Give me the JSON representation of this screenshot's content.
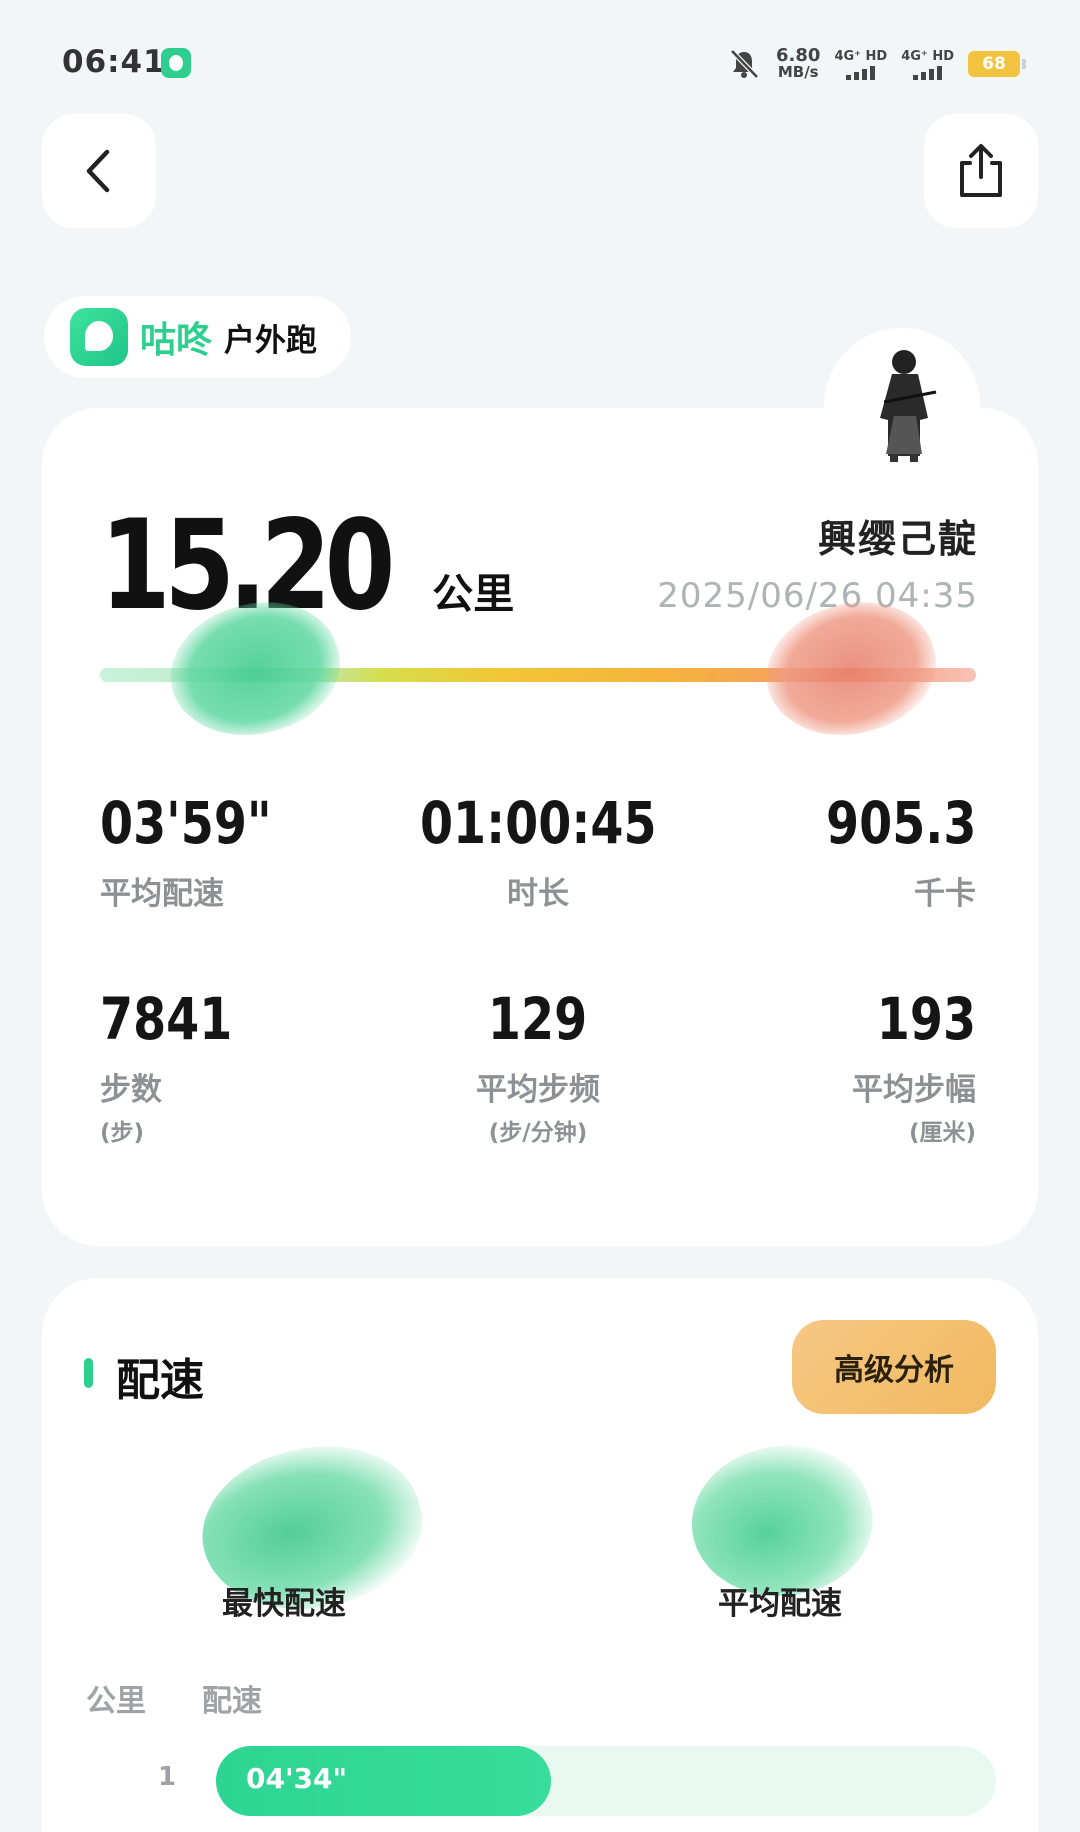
{
  "status_bar": {
    "time": "06:41",
    "net_speed_value": "6.80",
    "net_speed_unit": "MB/s",
    "sim1_label": "4G⁺ HD",
    "sim2_label": "4G⁺ HD",
    "battery": "68",
    "battery_color": "#f2c33e"
  },
  "header": {
    "back_icon": "chevron-left-icon",
    "share_icon": "share-icon"
  },
  "app_tag": {
    "app_name": "咕咚",
    "run_type": "户外跑",
    "brand_color": "#2ecf8e"
  },
  "summary": {
    "distance": "15.20",
    "distance_unit": "公里",
    "nickname": "興缨己靛",
    "datetime": "2025/06/26 04:35"
  },
  "stats": [
    {
      "value": "03'59\"",
      "label": "平均配速",
      "sub": ""
    },
    {
      "value": "01:00:45",
      "label": "时长",
      "sub": ""
    },
    {
      "value": "905.3",
      "label": "千卡",
      "sub": ""
    },
    {
      "value": "7841",
      "label": "步数",
      "sub": "(步)"
    },
    {
      "value": "129",
      "label": "平均步频",
      "sub": "(步/分钟)"
    },
    {
      "value": "193",
      "label": "平均步幅",
      "sub": "(厘米)"
    }
  ],
  "pace_section": {
    "title": "配速",
    "advanced_button": "高级分析",
    "fastest_label": "最快配速",
    "average_label": "平均配速",
    "col_km": "公里",
    "col_pace": "配速",
    "splits": [
      {
        "km": "1",
        "pace": "04'34\"",
        "fill_fraction": 0.43
      }
    ]
  }
}
